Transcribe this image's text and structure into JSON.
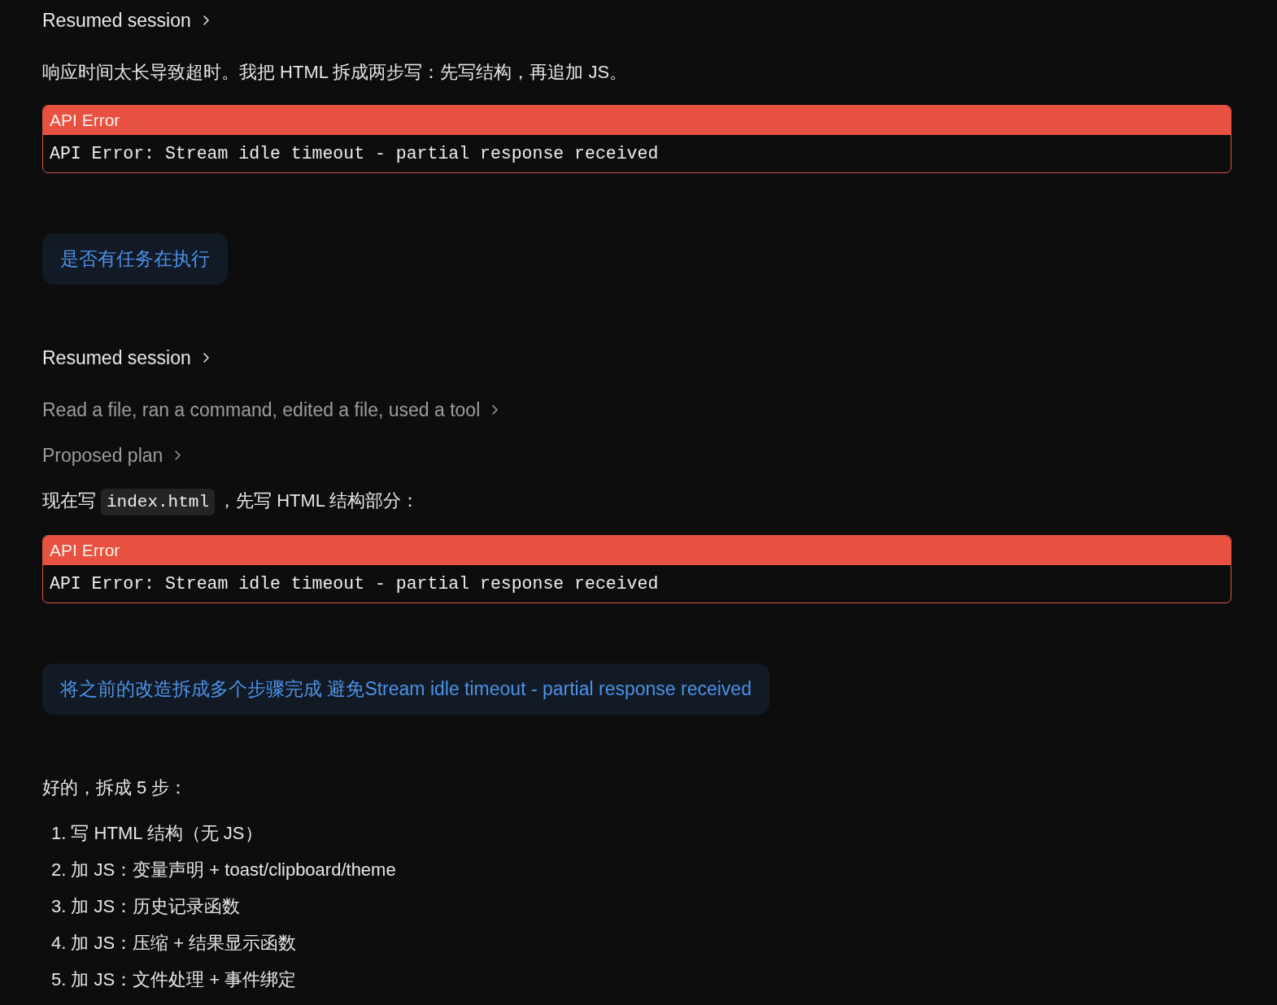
{
  "transcript": [
    {
      "kind": "session",
      "label": "Resumed session",
      "expanded": false
    },
    {
      "kind": "text",
      "parts": [
        {
          "kind": "plain",
          "text": "响应时间太长导致超时。我把 HTML 拆成两步写：先写结构，再追加 JS。"
        }
      ]
    },
    {
      "kind": "error",
      "title": "API Error",
      "message": "API Error: Stream idle timeout - partial response received"
    },
    {
      "kind": "user",
      "text": "是否有任务在执行"
    },
    {
      "kind": "session",
      "label": "Resumed session",
      "expanded": false
    },
    {
      "kind": "activity",
      "label": "Read a file, ran a command, edited a file, used a tool",
      "expanded": false
    },
    {
      "kind": "activity",
      "label": "Proposed plan",
      "expanded": false
    },
    {
      "kind": "text",
      "parts": [
        {
          "kind": "plain",
          "text": "现在写"
        },
        {
          "kind": "code",
          "text": "index.html"
        },
        {
          "kind": "plain",
          "text": "，先写 HTML 结构部分："
        }
      ]
    },
    {
      "kind": "error",
      "title": "API Error",
      "message": "API Error: Stream idle timeout - partial response received"
    },
    {
      "kind": "user",
      "text": "将之前的改造拆成多个步骤完成 避免Stream idle timeout - partial response received"
    },
    {
      "kind": "text",
      "parts": [
        {
          "kind": "plain",
          "text": "好的，拆成 5 步："
        }
      ]
    },
    {
      "kind": "list",
      "items": [
        "1. 写 HTML 结构（无 JS）",
        "2. 加 JS：变量声明 + toast/clipboard/theme",
        "3. 加 JS：历史记录函数",
        "4. 加 JS：压缩 + 结果显示函数",
        "5. 加 JS：文件处理 + 事件绑定"
      ]
    }
  ]
}
